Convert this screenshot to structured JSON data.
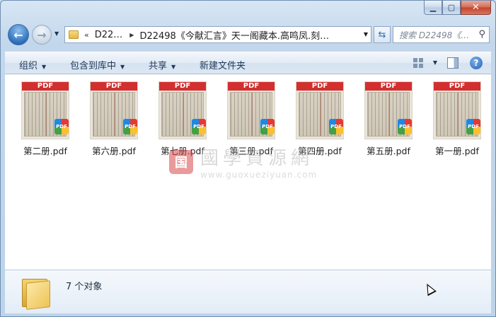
{
  "nav": {
    "overflow_chevron": "«",
    "crumbs": [
      "D22…",
      "D22498《今献汇言》天一阁藏本.高鸣凤.刻…"
    ],
    "search_placeholder": "搜索 D22498《…"
  },
  "toolbar": {
    "organize": "组织",
    "include_in_library": "包含到库中",
    "share": "共享",
    "new_folder": "新建文件夹"
  },
  "thumb_label": "PDF",
  "badge_label": "PDF",
  "files": [
    {
      "name": "第二册.pdf"
    },
    {
      "name": "第六册.pdf"
    },
    {
      "name": "第七册.pdf"
    },
    {
      "name": "第三册.pdf"
    },
    {
      "name": "第四册.pdf"
    },
    {
      "name": "第五册.pdf"
    },
    {
      "name": "第一册.pdf"
    }
  ],
  "watermark": {
    "seal": "国",
    "title": "國學資源網",
    "url": "www.guoxueziyuan.com"
  },
  "status": {
    "item_count": "7 个对象"
  },
  "colors": {
    "pdf_red": "#d32f2f",
    "window_frame": "#c3d7ec",
    "close_red": "#c1432b"
  }
}
